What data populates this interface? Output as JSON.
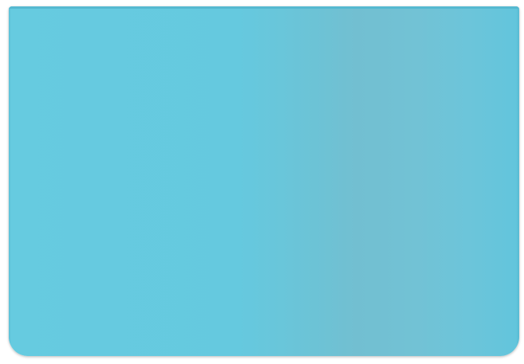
{
  "panel": {
    "colors": {
      "base": "#66cbe0",
      "band": "#72bfd1",
      "edge": "#55b9d1"
    }
  }
}
